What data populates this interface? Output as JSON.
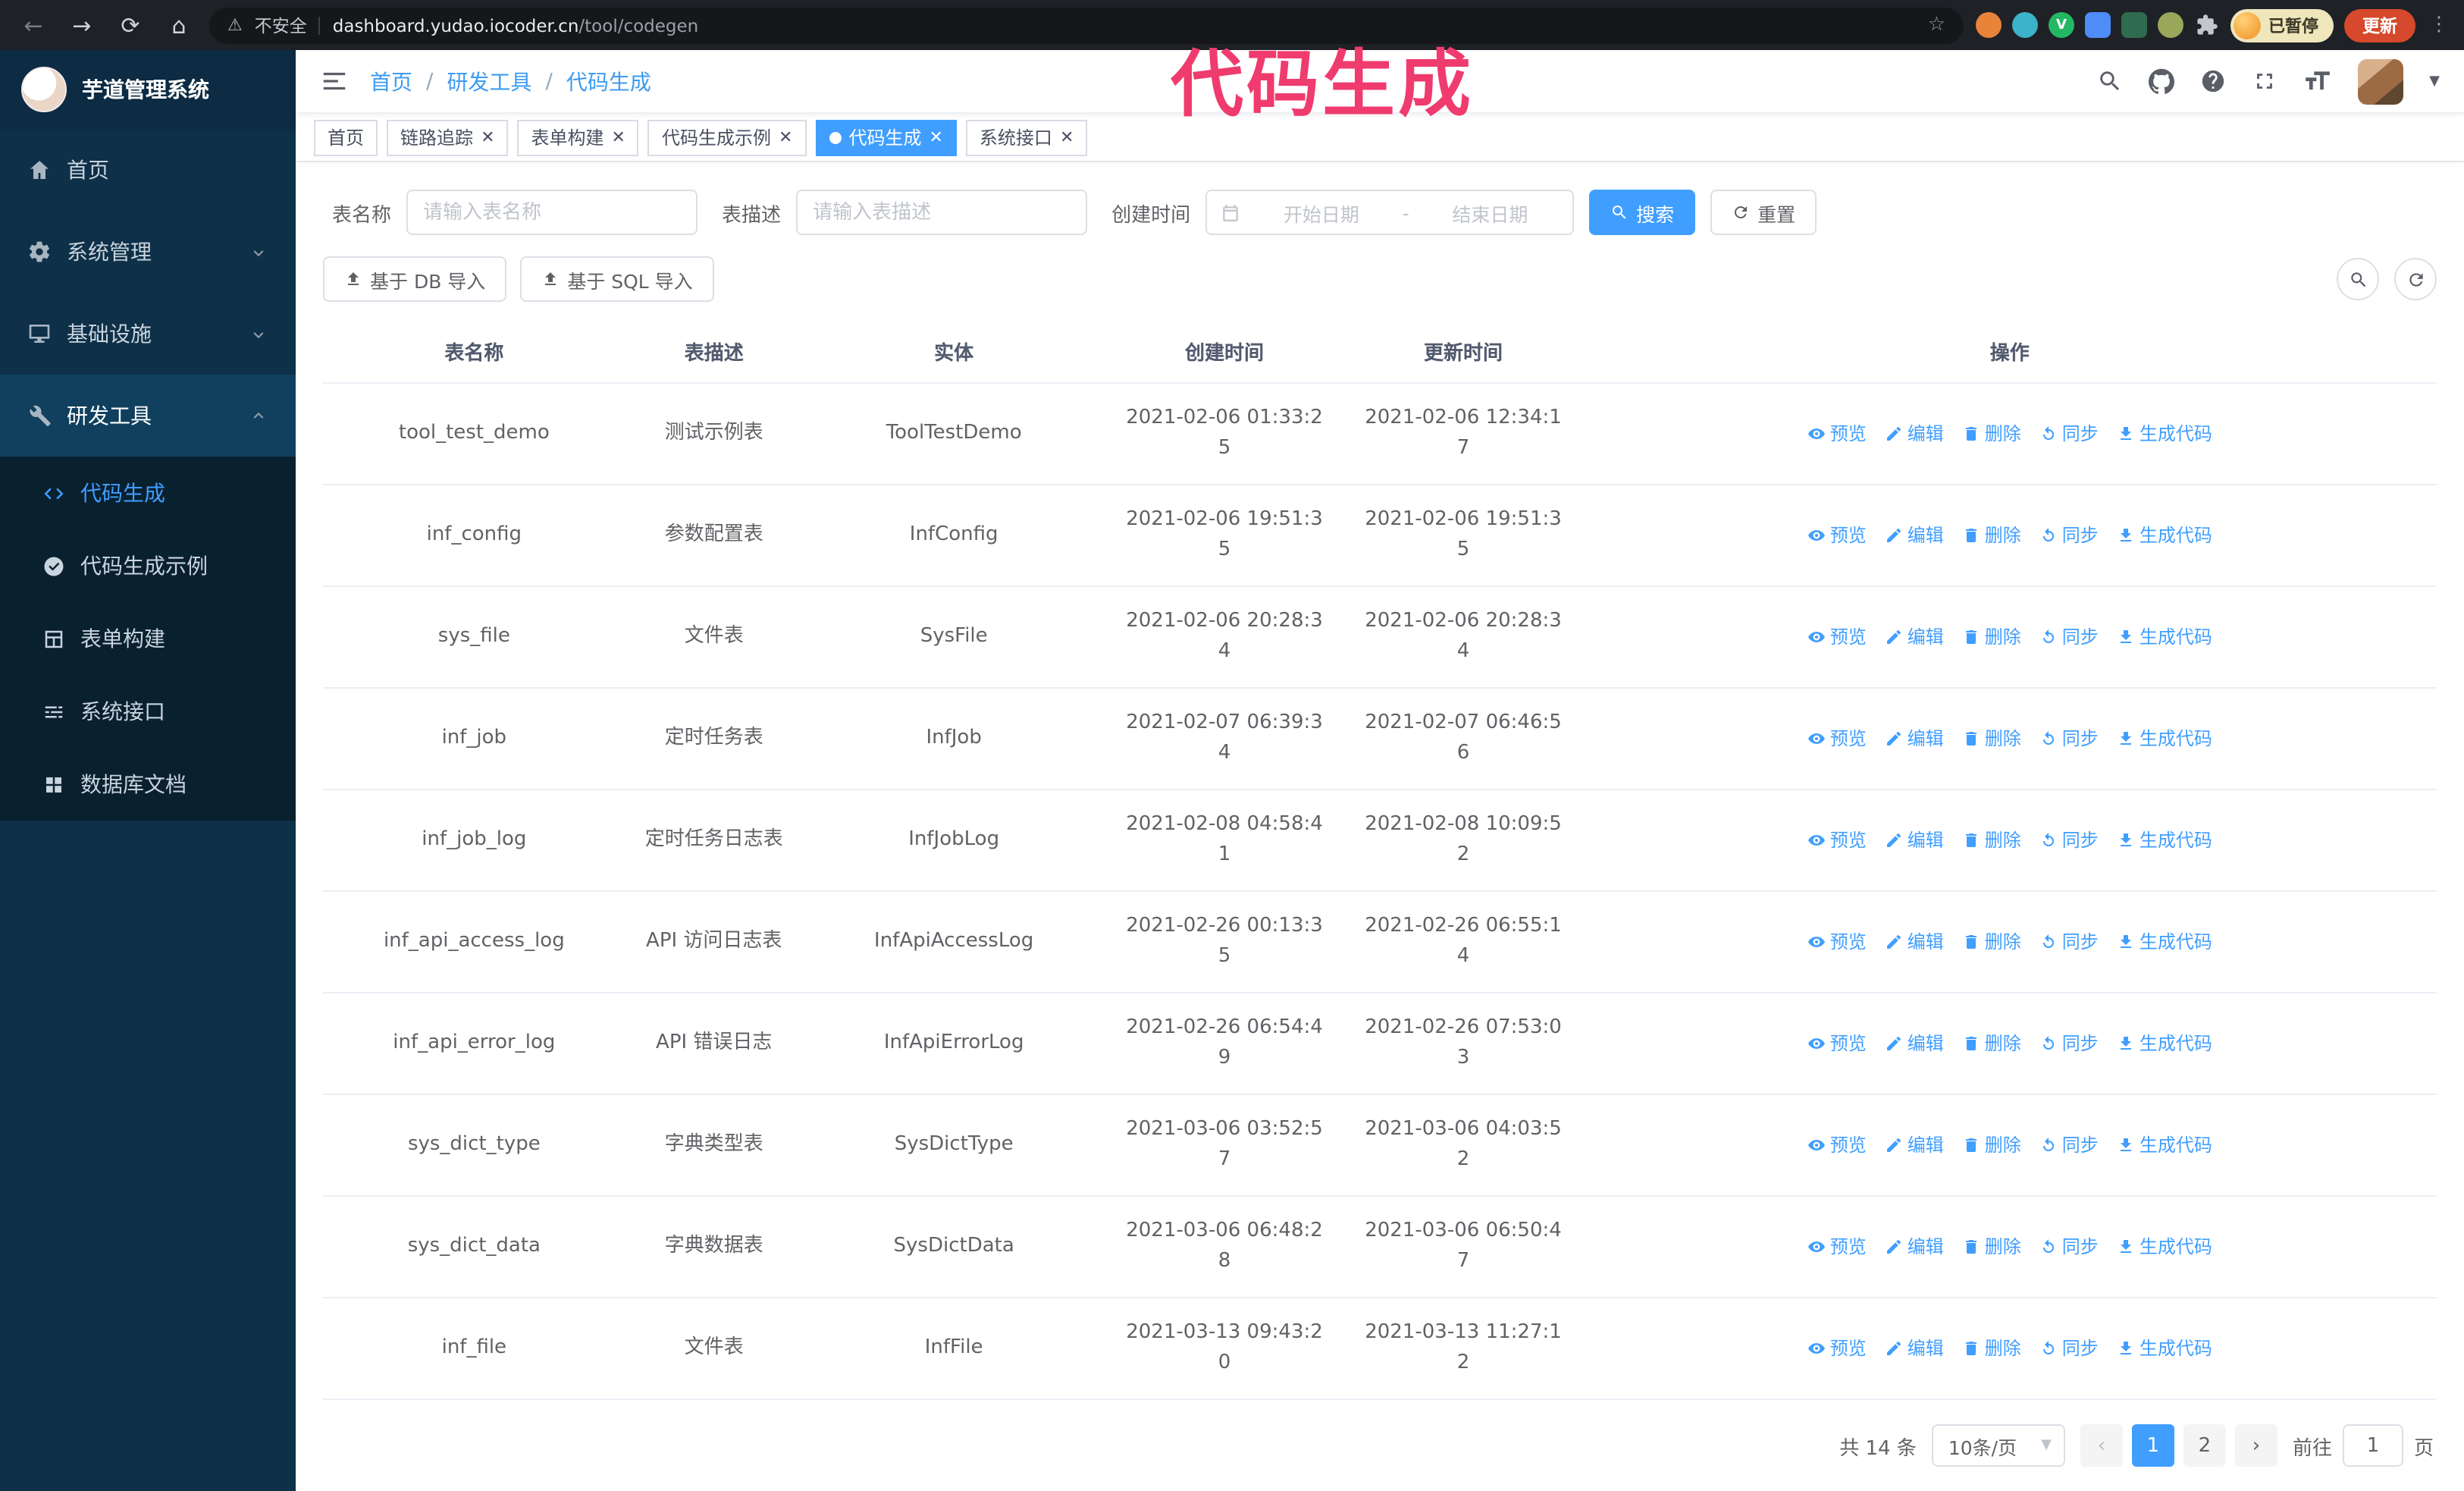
{
  "browser": {
    "warning": "不安全",
    "url_host": "dashboard.yudao.iocoder.cn",
    "url_path": "/tool/codegen",
    "paused_badge": "已暂停",
    "update_button": "更新"
  },
  "annotation": {
    "text": "代码生成",
    "color": "#ef3b6d"
  },
  "sidebar": {
    "logo_title": "芋道管理系统",
    "items": [
      {
        "label": "首页",
        "icon": "home",
        "arrow": "",
        "active": false
      },
      {
        "label": "系统管理",
        "icon": "gear",
        "arrow": "down",
        "active": false
      },
      {
        "label": "基础设施",
        "icon": "monitor",
        "arrow": "down",
        "active": false
      },
      {
        "label": "研发工具",
        "icon": "tools",
        "arrow": "up",
        "active": true
      }
    ],
    "subitems": [
      {
        "label": "代码生成",
        "icon": "code",
        "active": true
      },
      {
        "label": "代码生成示例",
        "icon": "badge",
        "active": false
      },
      {
        "label": "表单构建",
        "icon": "form",
        "active": false
      },
      {
        "label": "系统接口",
        "icon": "api",
        "active": false
      },
      {
        "label": "数据库文档",
        "icon": "grid",
        "active": false
      }
    ]
  },
  "breadcrumb": {
    "items": [
      "首页",
      "研发工具",
      "代码生成"
    ]
  },
  "tabs": [
    {
      "label": "首页",
      "closable": false,
      "active": false
    },
    {
      "label": "链路追踪",
      "closable": true,
      "active": false
    },
    {
      "label": "表单构建",
      "closable": true,
      "active": false
    },
    {
      "label": "代码生成示例",
      "closable": true,
      "active": false
    },
    {
      "label": "代码生成",
      "closable": true,
      "active": true
    },
    {
      "label": "系统接口",
      "closable": true,
      "active": false
    }
  ],
  "filters": {
    "table_name_label": "表名称",
    "table_name_placeholder": "请输入表名称",
    "table_desc_label": "表描述",
    "table_desc_placeholder": "请输入表描述",
    "create_time_label": "创建时间",
    "date_start_placeholder": "开始日期",
    "date_separator": "-",
    "date_end_placeholder": "结束日期",
    "search_button": "搜索",
    "reset_button": "重置"
  },
  "toolbar": {
    "import_db": "基于 DB 导入",
    "import_sql": "基于 SQL 导入"
  },
  "table": {
    "columns": [
      "表名称",
      "表描述",
      "实体",
      "创建时间",
      "更新时间",
      "操作"
    ],
    "actions": [
      "预览",
      "编辑",
      "删除",
      "同步",
      "生成代码"
    ],
    "rows": [
      {
        "name": "tool_test_demo",
        "desc": "测试示例表",
        "entity": "ToolTestDemo",
        "created": "2021-02-06 01:33:25",
        "updated": "2021-02-06 12:34:17"
      },
      {
        "name": "inf_config",
        "desc": "参数配置表",
        "entity": "InfConfig",
        "created": "2021-02-06 19:51:35",
        "updated": "2021-02-06 19:51:35"
      },
      {
        "name": "sys_file",
        "desc": "文件表",
        "entity": "SysFile",
        "created": "2021-02-06 20:28:34",
        "updated": "2021-02-06 20:28:34"
      },
      {
        "name": "inf_job",
        "desc": "定时任务表",
        "entity": "InfJob",
        "created": "2021-02-07 06:39:34",
        "updated": "2021-02-07 06:46:56"
      },
      {
        "name": "inf_job_log",
        "desc": "定时任务日志表",
        "entity": "InfJobLog",
        "created": "2021-02-08 04:58:41",
        "updated": "2021-02-08 10:09:52"
      },
      {
        "name": "inf_api_access_log",
        "desc": "API 访问日志表",
        "entity": "InfApiAccessLog",
        "created": "2021-02-26 00:13:35",
        "updated": "2021-02-26 06:55:14"
      },
      {
        "name": "inf_api_error_log",
        "desc": "API 错误日志",
        "entity": "InfApiErrorLog",
        "created": "2021-02-26 06:54:49",
        "updated": "2021-02-26 07:53:03"
      },
      {
        "name": "sys_dict_type",
        "desc": "字典类型表",
        "entity": "SysDictType",
        "created": "2021-03-06 03:52:57",
        "updated": "2021-03-06 04:03:52"
      },
      {
        "name": "sys_dict_data",
        "desc": "字典数据表",
        "entity": "SysDictData",
        "created": "2021-03-06 06:48:28",
        "updated": "2021-03-06 06:50:47"
      },
      {
        "name": "inf_file",
        "desc": "文件表",
        "entity": "InfFile",
        "created": "2021-03-13 09:43:20",
        "updated": "2021-03-13 11:27:12"
      }
    ]
  },
  "pagination": {
    "total": "共 14 条",
    "page_size": "10条/页",
    "pages": [
      "1",
      "2"
    ],
    "active_page": "1",
    "goto_label": "前往",
    "goto_value": "1",
    "goto_suffix": "页"
  }
}
